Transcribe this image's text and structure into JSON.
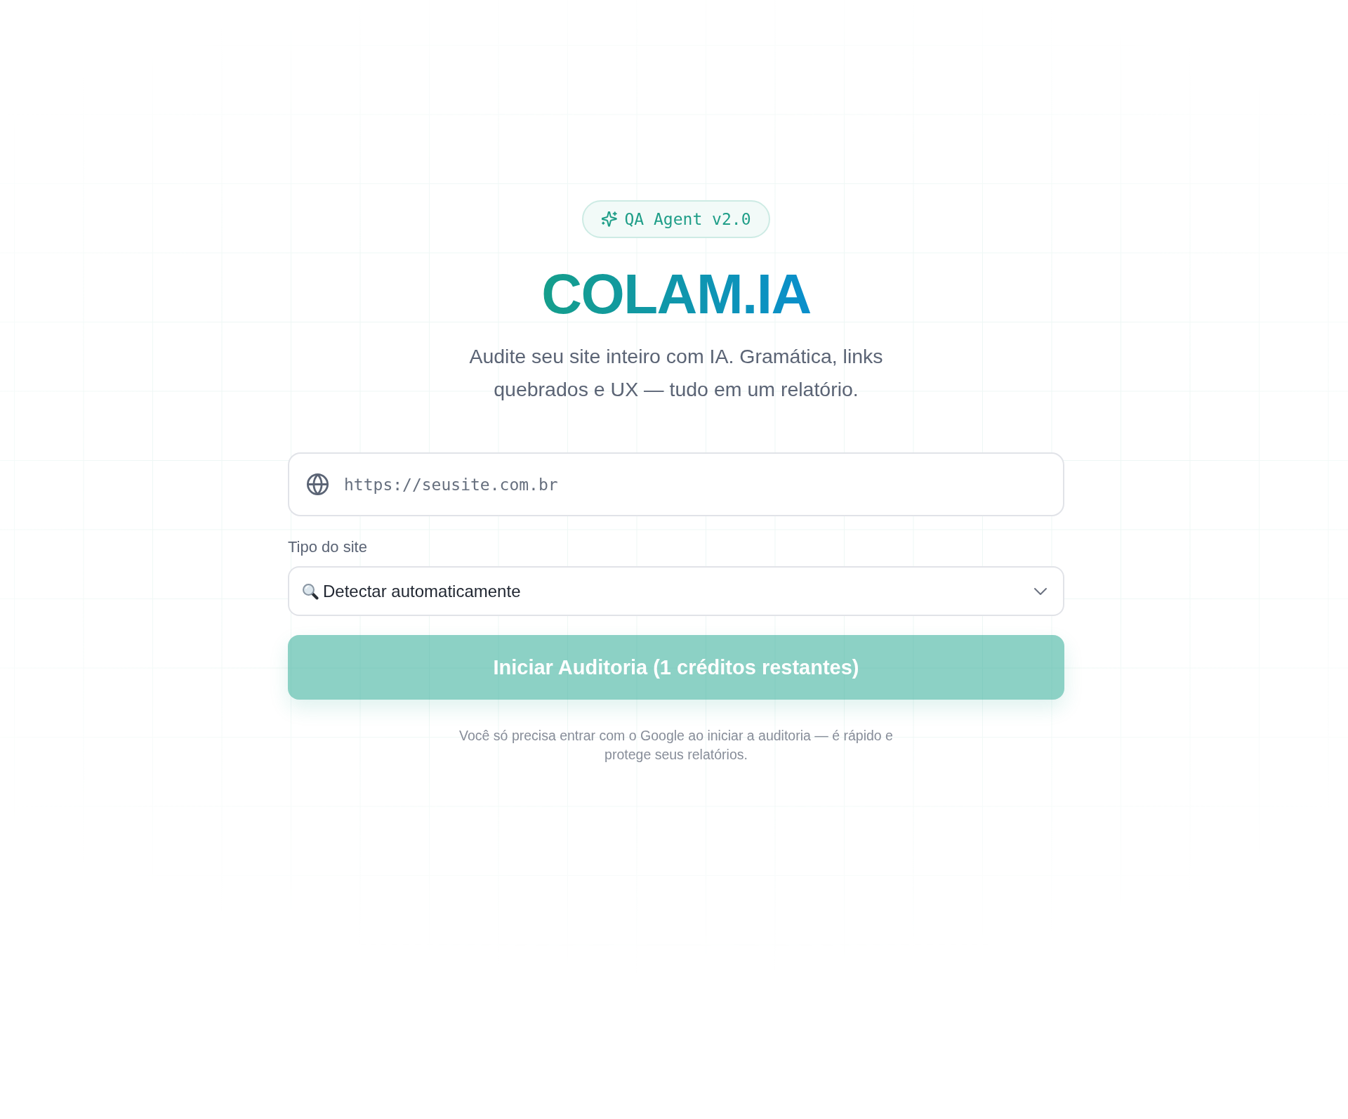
{
  "badge": {
    "label": "QA Agent v2.0"
  },
  "title": "COLAM.IA",
  "subtitle": "Audite seu site inteiro com IA. Gramática, links quebrados e UX — tudo em um relatório.",
  "url_field": {
    "placeholder": "https://seusite.com.br"
  },
  "site_type": {
    "label": "Tipo do site",
    "value": "Detectar automaticamente"
  },
  "start_button": {
    "label": "Iniciar Auditoria (1 créditos restantes)",
    "disabled": true
  },
  "note": "Você só precisa entrar com o Google ao iniciar a auditoria — é rápido e protege seus relatórios."
}
